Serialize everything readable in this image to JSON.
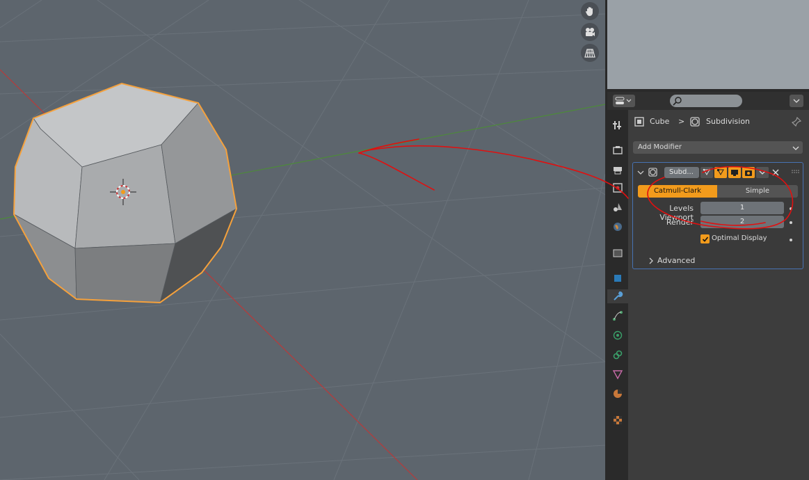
{
  "colors": {
    "viewport_bg": "#5d656d",
    "selection_outline": "#f5a13c",
    "x_axis": "#b83a3a",
    "y_axis": "#4d8a3a",
    "active_orange": "#f29b1c",
    "panel_border": "#4772b3",
    "annotation_red": "#e01010"
  },
  "viewport": {
    "nav_icons": [
      "hand-pan-icon",
      "camera-icon",
      "grid-ortho-icon"
    ]
  },
  "properties": {
    "search_placeholder": "",
    "breadcrumb": {
      "object": "Cube",
      "separator": ">",
      "modifier": "Subdivision"
    },
    "tabs": [
      "tool-icon",
      "render-icon",
      "output-icon",
      "view-layer-icon",
      "scene-icon",
      "world-icon",
      "collection-icon",
      "object-icon",
      "modifier-icon",
      "particles-icon",
      "physics-icon",
      "constraints-icon",
      "data-icon",
      "material-icon",
      "texture-icon"
    ],
    "active_tab": "modifier-icon",
    "add_modifier_label": "Add Modifier",
    "modifier": {
      "name": "Subd...",
      "mode_options": [
        "Catmull-Clark",
        "Simple"
      ],
      "selected_mode": "Catmull-Clark",
      "levels_viewport_label": "Levels Viewport",
      "levels_viewport_value": "1",
      "render_label": "Render",
      "render_value": "2",
      "optimal_display_label": "Optimal Display",
      "optimal_display_checked": true,
      "advanced_label": "Advanced"
    }
  }
}
